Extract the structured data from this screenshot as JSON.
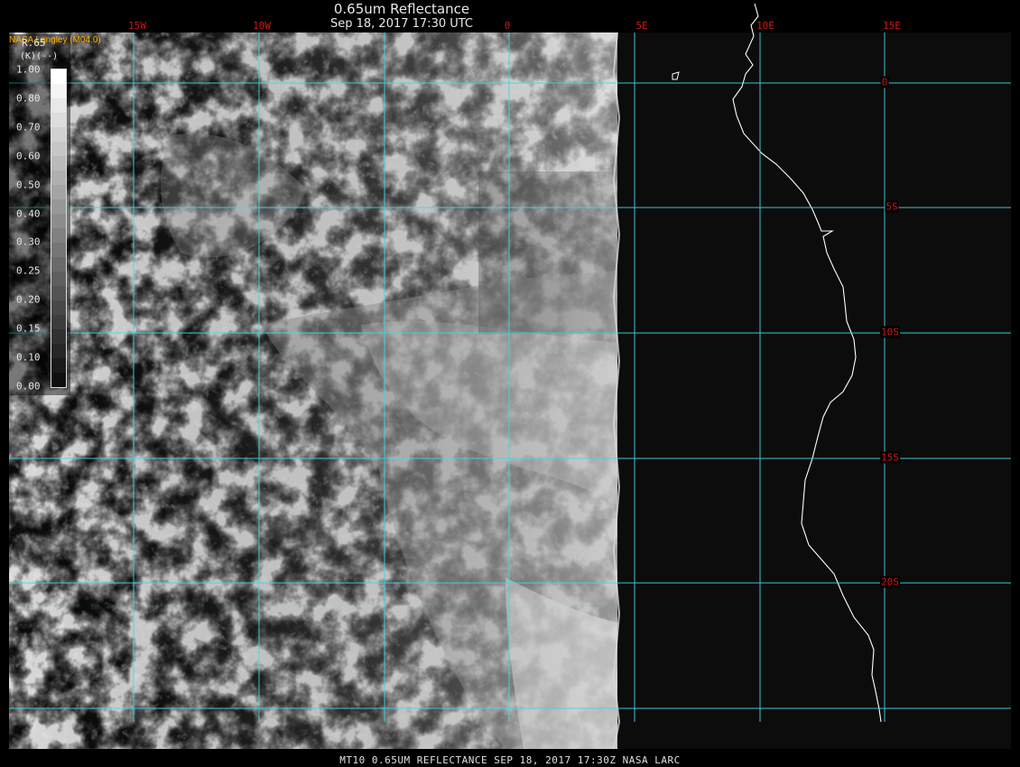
{
  "header": {
    "title": "0.65um Reflectance",
    "subtitle": "Sep 18, 2017 17:30 UTC",
    "brand": "NASA Langley (M04.0)"
  },
  "footer": {
    "text": "MT10  0.65UM REFLECTANCE   SEP 18, 2017 17:30Z   NASA LARC"
  },
  "legend": {
    "title": "R.65",
    "units": "(--)",
    "unit_prefix": "(K)",
    "ticks": [
      "1.00",
      "0.80",
      "0.70",
      "0.60",
      "0.50",
      "0.40",
      "0.30",
      "0.25",
      "0.20",
      "0.15",
      "0.10",
      "0.00"
    ]
  },
  "grid": {
    "longitude_labels": [
      "15W",
      "10W",
      "0",
      "5E",
      "10E",
      "15E"
    ],
    "latitude_labels": [
      "0",
      "5S",
      "10S",
      "15S",
      "20S"
    ],
    "grid_color": "#3fd8e8",
    "label_color": "#d01818"
  },
  "map": {
    "projection": "lat-lon",
    "longitude_range": [
      -20,
      15
    ],
    "latitude_range": [
      2,
      -26
    ],
    "data_edge_longitude": 4.2,
    "coastline_color": "#ffffff",
    "coastline_region": "southwest Africa (Gabon to Namibia)"
  }
}
